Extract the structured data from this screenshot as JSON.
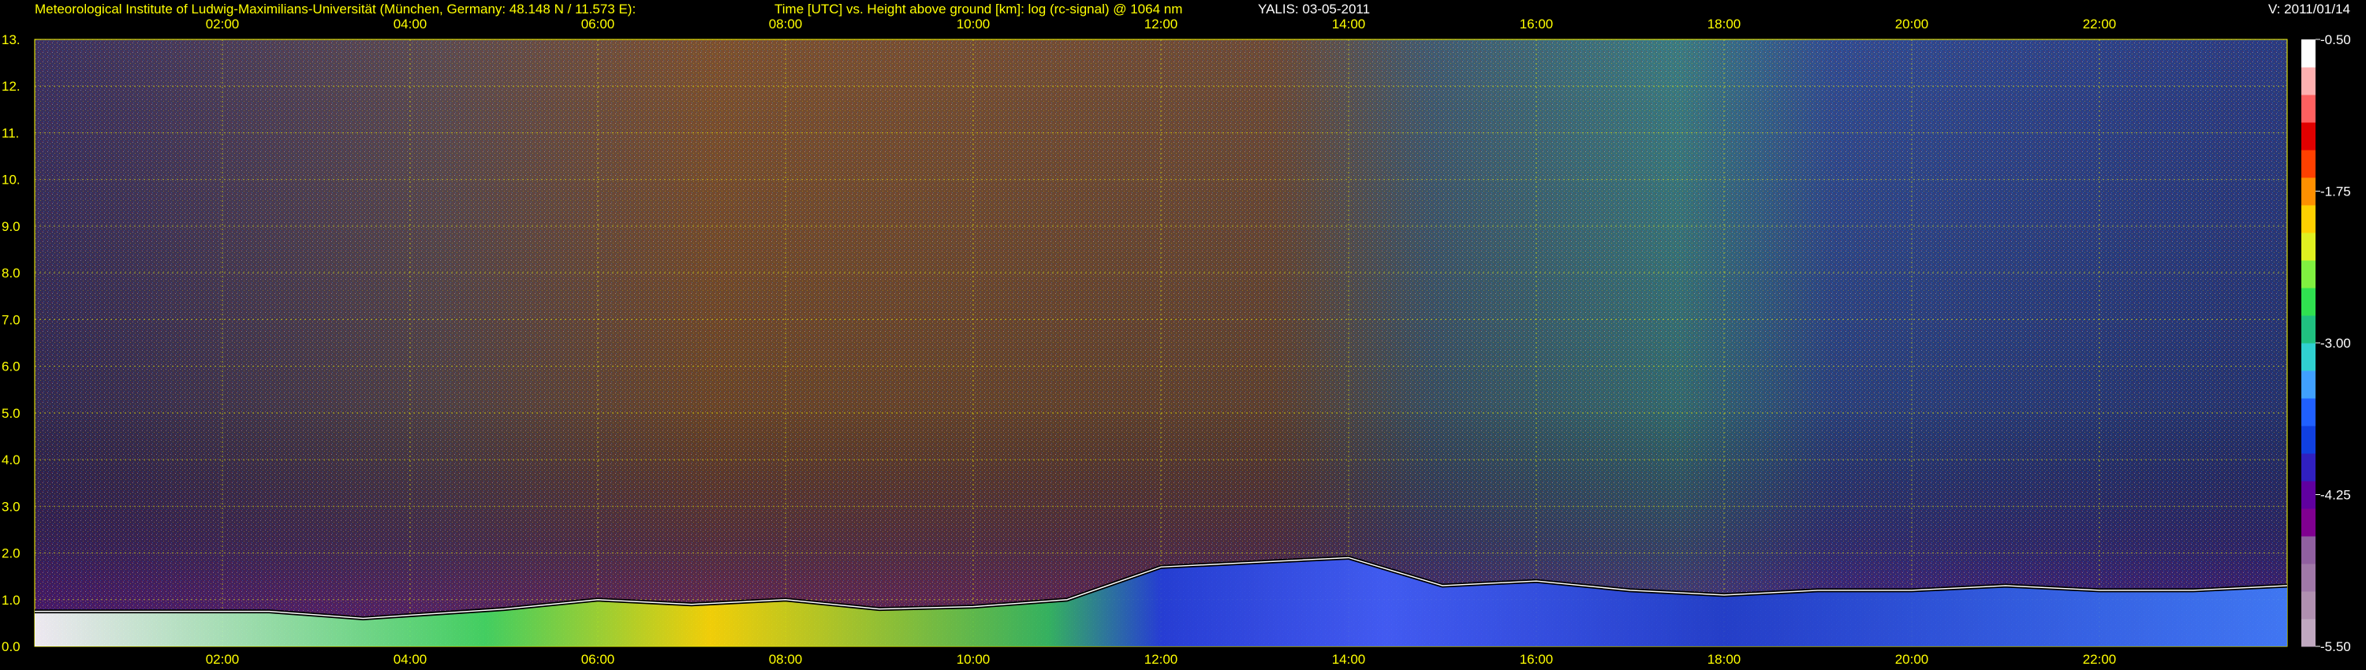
{
  "header": {
    "institute": "Meteorological Institute of Ludwig-Maximilians-Universität (München, Germany: 48.148 N / 11.573 E):",
    "plot_desc": "Time [UTC] vs. Height above ground [km]: log (rc-signal) @ 1064 nm",
    "station_date": "YALIS: 03-05-2011",
    "version": "V: 2011/01/14"
  },
  "chart_data": {
    "type": "heatmap",
    "title": "Time [UTC] vs. Height above ground [km]: log (rc-signal) @ 1064 nm",
    "x_ticks": [
      "02:00",
      "04:00",
      "06:00",
      "08:00",
      "10:00",
      "12:00",
      "14:00",
      "16:00",
      "18:00",
      "20:00",
      "22:00"
    ],
    "x_range_hours": [
      0,
      24
    ],
    "y_ticks": [
      "0.0",
      "1.0",
      "2.0",
      "3.0",
      "4.0",
      "5.0",
      "6.0",
      "7.0",
      "8.0",
      "9.0",
      "10.",
      "11.",
      "12.",
      "13."
    ],
    "y_range_km": [
      0,
      13
    ],
    "grid": true,
    "colorbar": {
      "ticks": [
        "-0.50",
        "-1.75",
        "-3.00",
        "-4.25",
        "-5.50"
      ],
      "range": [
        -5.5,
        -0.5
      ],
      "palette": [
        "#c0a8c0",
        "#b090b0",
        "#a078a8",
        "#9060a0",
        "#800090",
        "#6000a0",
        "#3020c0",
        "#1040e0",
        "#2060ff",
        "#40a0ff",
        "#30d0d0",
        "#20c080",
        "#30e050",
        "#80f040",
        "#e0f020",
        "#ffd000",
        "#ff9000",
        "#ff4000",
        "#e00000",
        "#ff6060",
        "#ffb0b0",
        "#ffffff"
      ]
    },
    "boundary_layer_top_km": [
      {
        "t": 0.0,
        "h": 0.75
      },
      {
        "t": 2.5,
        "h": 0.75
      },
      {
        "t": 3.5,
        "h": 0.6
      },
      {
        "t": 5.0,
        "h": 0.8
      },
      {
        "t": 6.0,
        "h": 1.0
      },
      {
        "t": 7.0,
        "h": 0.9
      },
      {
        "t": 8.0,
        "h": 1.0
      },
      {
        "t": 9.0,
        "h": 0.8
      },
      {
        "t": 10.0,
        "h": 0.85
      },
      {
        "t": 11.0,
        "h": 1.0
      },
      {
        "t": 12.0,
        "h": 1.7
      },
      {
        "t": 13.0,
        "h": 1.8
      },
      {
        "t": 14.0,
        "h": 1.9
      },
      {
        "t": 15.0,
        "h": 1.3
      },
      {
        "t": 16.0,
        "h": 1.4
      },
      {
        "t": 17.0,
        "h": 1.2
      },
      {
        "t": 18.0,
        "h": 1.1
      },
      {
        "t": 19.0,
        "h": 1.2
      },
      {
        "t": 20.0,
        "h": 1.2
      },
      {
        "t": 21.0,
        "h": 1.3
      },
      {
        "t": 22.0,
        "h": 1.2
      },
      {
        "t": 23.0,
        "h": 1.2
      },
      {
        "t": 24.0,
        "h": 1.3
      }
    ]
  }
}
